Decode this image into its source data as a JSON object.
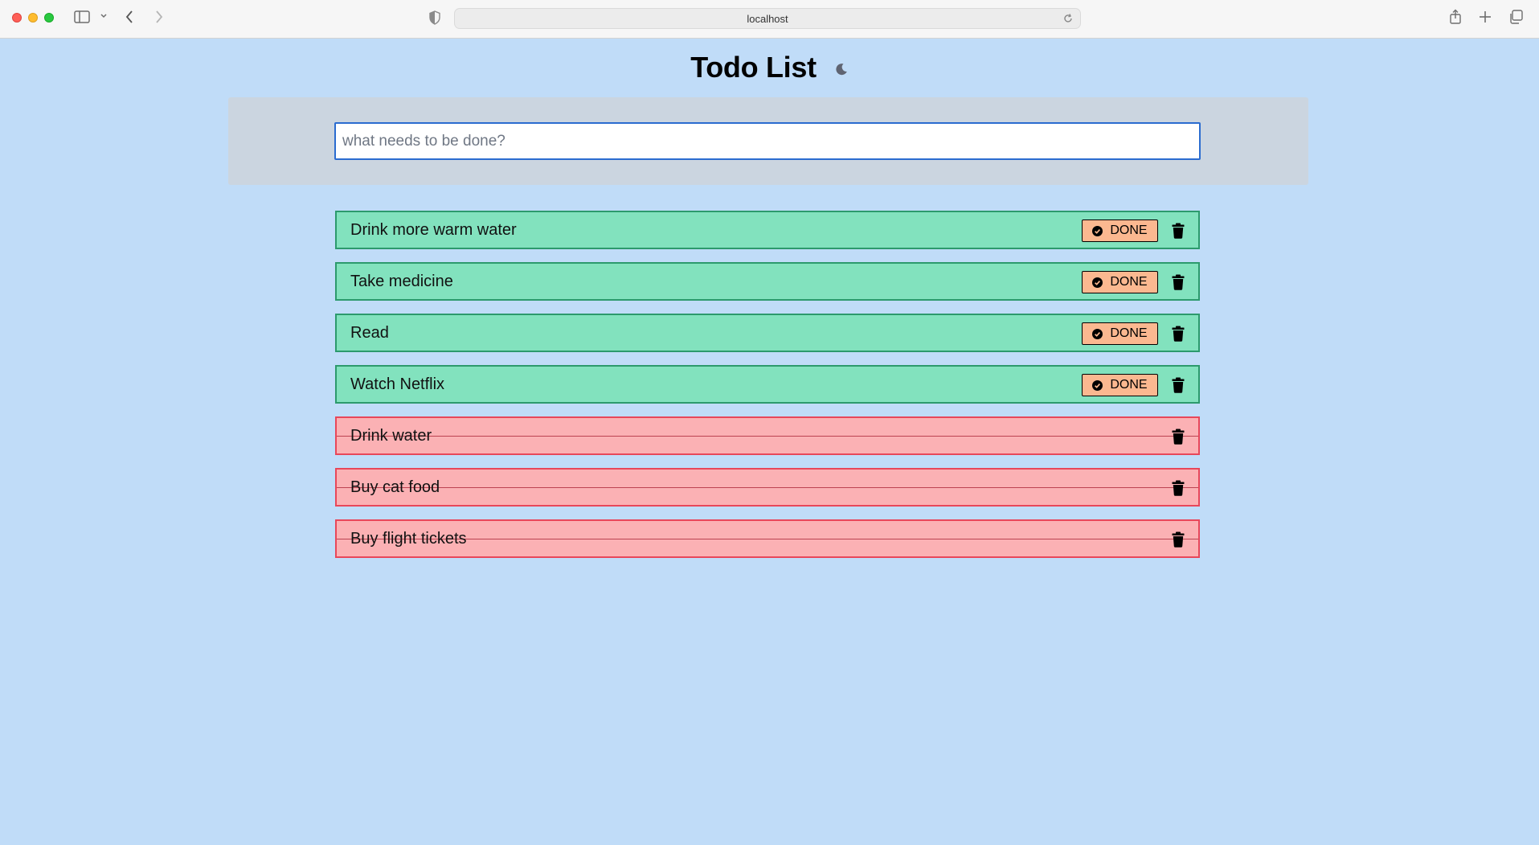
{
  "browser": {
    "url": "localhost"
  },
  "app": {
    "title": "Todo List",
    "theme_toggle_icon": "moon-icon",
    "input_placeholder": "what needs to be done?",
    "input_value": ""
  },
  "todos": [
    {
      "text": "Drink more warm water",
      "status": "pending",
      "action_label": "DONE"
    },
    {
      "text": "Take medicine",
      "status": "pending",
      "action_label": "DONE"
    },
    {
      "text": "Read",
      "status": "pending",
      "action_label": "DONE"
    },
    {
      "text": "Watch Netflix",
      "status": "pending",
      "action_label": "DONE"
    },
    {
      "text": "Drink water",
      "status": "done"
    },
    {
      "text": "Buy cat food",
      "status": "done"
    },
    {
      "text": "Buy flight tickets",
      "status": "done"
    }
  ],
  "colors": {
    "page_background": "#c0dcf8",
    "pending_background": "#82e2be",
    "pending_border": "#2c9a6d",
    "done_background": "#fbb1b4",
    "done_border": "#e8475a",
    "done_button": "#fbb890",
    "input_focus_border": "#2b6cd0"
  }
}
